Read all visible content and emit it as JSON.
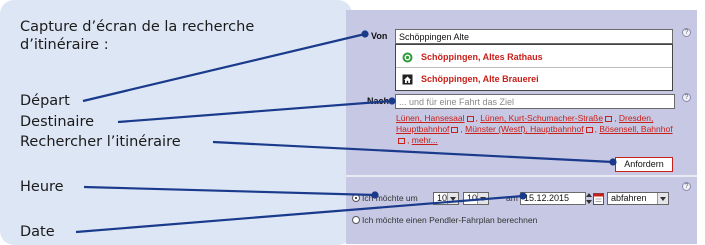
{
  "annotations": {
    "caption": "Capture d’écran de la recherche d’itinéraire :",
    "depart": "Départ",
    "destination": "Destinaire",
    "search": "Rechercher l’itinéraire",
    "time": "Heure",
    "date": "Date"
  },
  "form": {
    "from_label": "Von",
    "from_value": "Schöppingen Alte",
    "suggestions": [
      {
        "icon": "stop-icon",
        "label": "Schöppingen, Altes Rathaus"
      },
      {
        "icon": "building-icon",
        "label": "Schöppingen, Alte Brauerei"
      }
    ],
    "to_label": "Nach",
    "to_placeholder": "... und für eine Fahrt das Ziel",
    "recent": [
      "Lünen, Hansesaal",
      "Lünen, Kurt-Schumacher-Straße",
      "Dresden, Hauptbahnhof",
      "Münster (Westf), Hauptbahnhof",
      "Bösensell, Bahnhof",
      "mehr..."
    ],
    "submit_label": "Anfordern",
    "time_prefix": "Ich möchte um",
    "hour": "10",
    "minute": "10",
    "am_label": "am",
    "date": "15.12.2015",
    "mode": "abfahren",
    "commuter_label": "Ich möchte einen Pendler-Fahrplan berechnen"
  },
  "colors": {
    "annotation_bg": "#dde6f4",
    "panel_bg": "#c7c8e3",
    "accent_red": "#c8201a",
    "callout_line": "#1a3a8c"
  }
}
